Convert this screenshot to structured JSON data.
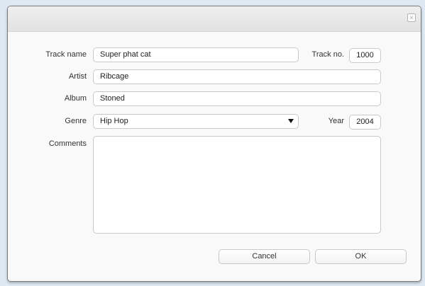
{
  "dialog": {
    "close_glyph": "×",
    "close_icon": "close-icon"
  },
  "form": {
    "track_name": {
      "label": "Track name",
      "value": "Super phat cat"
    },
    "track_no": {
      "label": "Track no.",
      "value": "1000"
    },
    "artist": {
      "label": "Artist",
      "value": "Ribcage"
    },
    "album": {
      "label": "Album",
      "value": "Stoned"
    },
    "genre": {
      "label": "Genre",
      "value": "Hip Hop",
      "icon": "chevron-down-icon"
    },
    "year": {
      "label": "Year",
      "value": "2004"
    },
    "comments": {
      "label": "Comments",
      "value": ""
    }
  },
  "buttons": {
    "cancel": "Cancel",
    "ok": "OK"
  }
}
